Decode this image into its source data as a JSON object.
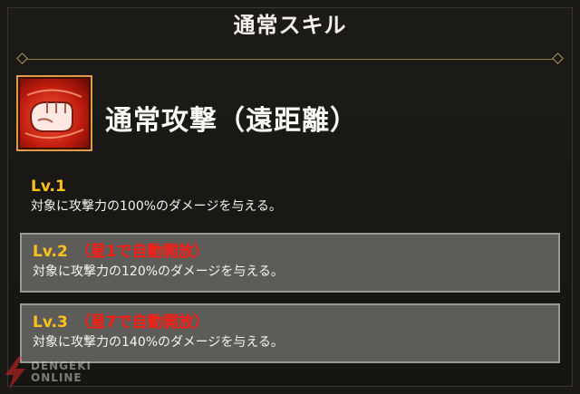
{
  "header": {
    "title": "通常スキル"
  },
  "skill": {
    "icon": "fist-punch-icon",
    "name": "通常攻撃（遠距離）"
  },
  "levels": [
    {
      "label": "Lv.1",
      "note": "",
      "description": "対象に攻撃力の100%のダメージを与える。"
    },
    {
      "label": "Lv.2",
      "note": "（星1で自動開放）",
      "description": "対象に攻撃力の120%のダメージを与える。"
    },
    {
      "label": "Lv.3",
      "note": "（星7で自動開放）",
      "description": "対象に攻撃力の140%のダメージを与える。"
    }
  ],
  "watermark": {
    "line1": "DENGEKI",
    "line2": "ONLINE"
  },
  "colors": {
    "level_label": "#ffc21c",
    "unlock_note": "#ff1c14",
    "box_fill": "#5e5c59",
    "divider": "#8e7a4d"
  }
}
